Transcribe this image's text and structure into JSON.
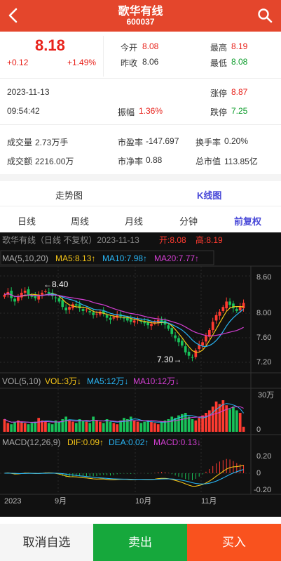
{
  "header": {
    "title": "歌华有线",
    "code": "600037"
  },
  "quote": {
    "price": "8.18",
    "change": "+0.12",
    "change_pct": "+1.49%",
    "open_label": "今开",
    "open": "8.08",
    "prev_close_label": "昨收",
    "prev_close": "8.06",
    "high_label": "最高",
    "high": "8.19",
    "low_label": "最低",
    "low": "8.08",
    "date": "2023-11-13",
    "time": "09:54:42",
    "amplitude_label": "振幅",
    "amplitude": "1.36%",
    "limit_up_label": "涨停",
    "limit_up": "8.87",
    "limit_down_label": "跌停",
    "limit_down": "7.25",
    "volume_label": "成交量",
    "volume": "2.73万手",
    "pe_label": "市盈率",
    "pe": "-147.697",
    "turnover_label": "换手率",
    "turnover": "0.20%",
    "amount_label": "成交额",
    "amount": "2216.00万",
    "pb_label": "市净率",
    "pb": "0.88",
    "market_cap_label": "总市值",
    "market_cap": "113.85亿"
  },
  "tabs": [
    "走势图",
    "K线图"
  ],
  "periods": [
    "日线",
    "周线",
    "月线",
    "分钟",
    "前复权"
  ],
  "chart_info": {
    "title": "歌华有线（日线 不复权）2023-11-13",
    "open_label": "开:8.08",
    "high_label": "高:8.19",
    "ma_label": "MA(5,10,20)",
    "ma5": "MA5:8.13↑",
    "ma10": "MA10:7.98↑",
    "ma20": "MA20:7.77↑",
    "vol_label": "VOL(5,10)",
    "vol": "VOL:3万↓",
    "vol_ma5": "MA5:12万↓",
    "vol_ma10": "MA10:12万↓",
    "vol_axis": "30万",
    "vol_axis_zero": "0",
    "macd_label": "MACD(12,26,9)",
    "dif": "DIF:0.09↑",
    "dea": "DEA:0.02↑",
    "macd": "MACD:0.13↓",
    "max_mark": "←8.40",
    "min_mark": "7.30→",
    "date_labels": [
      "2023",
      "9月",
      "10月",
      "11月"
    ]
  },
  "chart_data": {
    "type": "candlestick",
    "y_ticks": [
      "8.60",
      "8.00",
      "7.60",
      "7.20"
    ],
    "macd_ticks": [
      "0.20",
      "0",
      "-0.20"
    ],
    "close": [
      8.3,
      8.34,
      8.25,
      8.2,
      8.28,
      8.33,
      8.36,
      8.3,
      8.27,
      8.25,
      8.3,
      8.33,
      8.35,
      8.32,
      8.28,
      8.25,
      8.2,
      8.12,
      8.07,
      8.12,
      8.16,
      8.14,
      8.1,
      8.06,
      8.08,
      8.04,
      8.0,
      8.02,
      8.05,
      8.02,
      7.96,
      7.93,
      7.97,
      8.0,
      7.98,
      7.96,
      7.92,
      7.9,
      7.92,
      7.94,
      7.9,
      7.88,
      7.85,
      7.87,
      7.9,
      7.93,
      7.9,
      7.86,
      7.8,
      7.72,
      7.66,
      7.6,
      7.55,
      7.45,
      7.4,
      7.38,
      7.48,
      7.56,
      7.6,
      7.7,
      7.78,
      7.9,
      8.0,
      8.05,
      8.12,
      8.2,
      8.15,
      8.1,
      8.06,
      8.12,
      8.18
    ],
    "volume": [
      10,
      7,
      6,
      8,
      9,
      8,
      7,
      6,
      7,
      8,
      11,
      9,
      8,
      7,
      6,
      9,
      8,
      10,
      12,
      9,
      8,
      7,
      10,
      9,
      8,
      7,
      12,
      9,
      8,
      7,
      10,
      8,
      7,
      6,
      9,
      11,
      10,
      12,
      9,
      8,
      7,
      8,
      9,
      8,
      7,
      6,
      8,
      9,
      10,
      12,
      11,
      13,
      14,
      15,
      12,
      10,
      9,
      11,
      13,
      15,
      17,
      20,
      24,
      22,
      25,
      21,
      18,
      20,
      17,
      15,
      4
    ],
    "ylim": [
      7.2,
      8.65
    ]
  },
  "actions": {
    "cancel": "取消自选",
    "sell": "卖出",
    "buy": "买入"
  }
}
